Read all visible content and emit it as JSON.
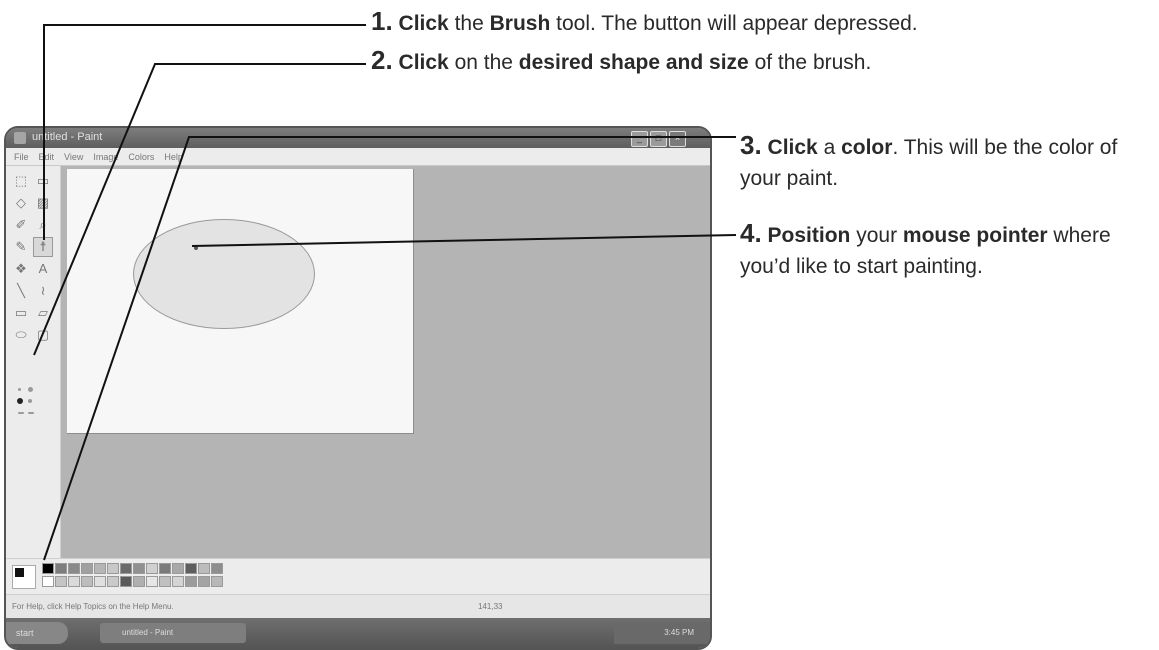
{
  "instructions": [
    {
      "num": "1.",
      "parts": [
        "Click",
        " the ",
        "Brush",
        " tool. The button will appear depressed."
      ]
    },
    {
      "num": "2.",
      "parts": [
        "Click",
        " on the ",
        "desired shape and size",
        " of the brush."
      ]
    },
    {
      "num": "3.",
      "parts": [
        "Click",
        " a ",
        "color",
        ". This will be the color of your paint."
      ]
    },
    {
      "num": "4.",
      "parts": [
        "Position",
        " your ",
        "mouse pointer",
        " where you’d like to start painting."
      ]
    }
  ],
  "window": {
    "title": "untitled - Paint",
    "controls": [
      "_",
      "□",
      "×"
    ]
  },
  "menu": [
    "File",
    "Edit",
    "View",
    "Image",
    "Colors",
    "Help"
  ],
  "tools": [
    "free-select",
    "rect-select",
    "eraser",
    "fill",
    "picker",
    "magnifier",
    "pencil",
    "brush",
    "airbrush",
    "text",
    "line",
    "curve",
    "rectangle",
    "polygon",
    "ellipse",
    "rounded-rect"
  ],
  "tool_glyphs": [
    "⬚",
    "▭",
    "◇",
    "▨",
    "✐",
    "⌕",
    "✎",
    "☨",
    "❖",
    "A",
    "╲",
    "≀",
    "▭",
    "▱",
    "⬭",
    "▢"
  ],
  "active_tool": "brush",
  "palette": [
    "#000000",
    "#7d7d7d",
    "#8a8a8a",
    "#a0a0a0",
    "#b5b5b5",
    "#c8c8c8",
    "#6a6a6a",
    "#909090",
    "#d0d0d0",
    "#7a7a7a",
    "#a8a8a8",
    "#5e5e5e",
    "#bcbcbc",
    "#8e8e8e",
    "#ffffff",
    "#c4c4c4",
    "#dadada",
    "#bdbdbd",
    "#e0e0e0",
    "#cacaca",
    "#5a5a5a",
    "#b0b0b0",
    "#e6e6e6",
    "#c0c0c0",
    "#d4d4d4",
    "#9c9c9c",
    "#a4a4a4",
    "#b8b8b8"
  ],
  "status": {
    "help": "For Help, click Help Topics on the Help Menu.",
    "coords": "141,33"
  },
  "taskbar": {
    "start": "start",
    "task": "untitled - Paint",
    "clock": "3:45 PM"
  }
}
